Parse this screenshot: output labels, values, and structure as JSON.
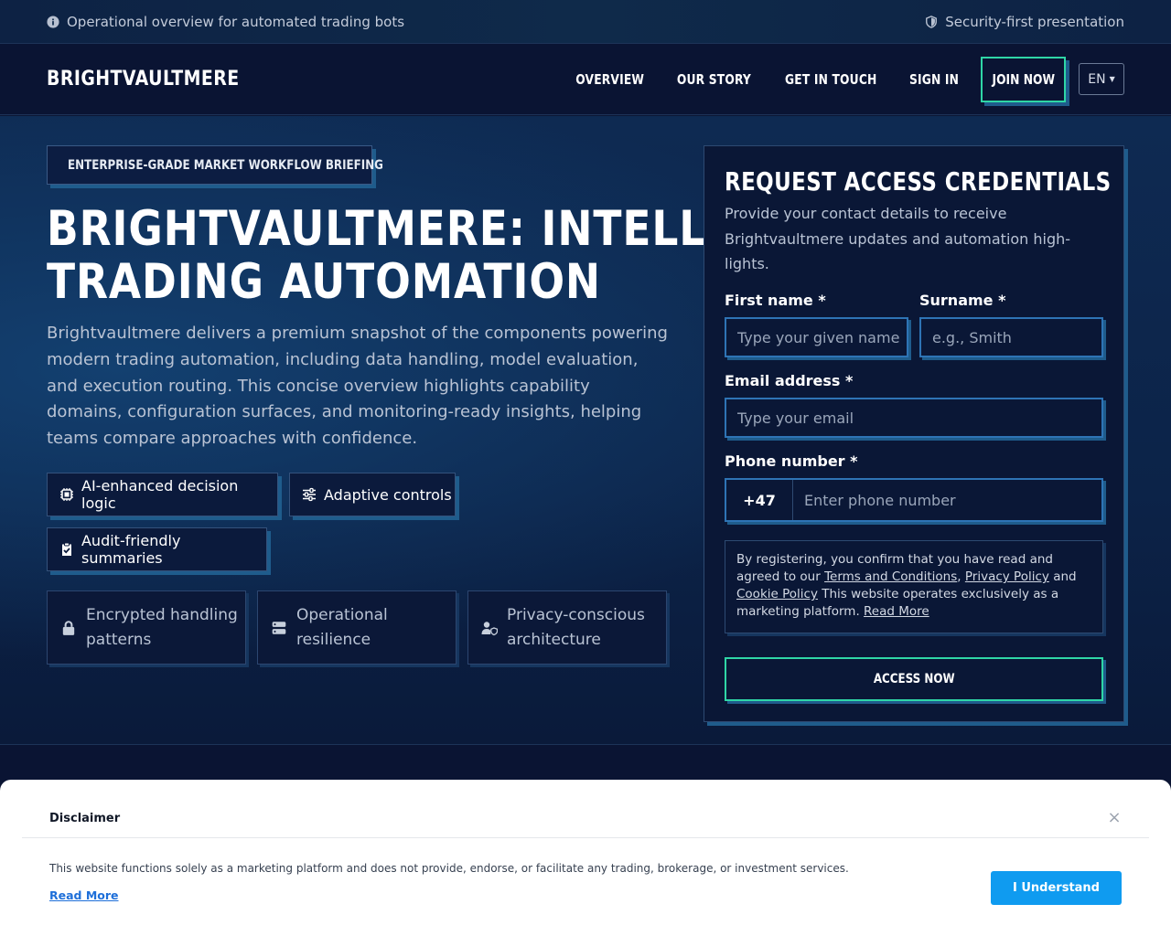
{
  "topbar": {
    "left_text": "Operational overview for automated trading bots",
    "right_text": "Security-first presentation"
  },
  "nav": {
    "brand": "BRIGHTVAULTMERE",
    "links": [
      "OVERVIEW",
      "OUR STORY",
      "GET IN TOUCH",
      "SIGN IN"
    ],
    "join_label": "JOIN NOW",
    "language": "EN"
  },
  "hero": {
    "badge": "ENTERPRISE-GRADE MARKET WORKFLOW BRIEFING",
    "headline_line1": "BRIGHTVAULTMERE: INTELLIGENT",
    "headline_line2": "TRADING AUTOMATION",
    "lead": "Brightvaultmere delivers a premium snapshot of the components powering modern trading automation, including data handling, model evaluation, and execution routing. This concise overview highlights capability domains, configuration surfaces, and monitoring-ready insights, helping teams compare approaches with confidence.",
    "chips": [
      "AI-enhanced decision logic",
      "Adaptive controls",
      "Audit-friendly summaries"
    ],
    "tiles": [
      {
        "line1": "Encrypted handling",
        "line2": "patterns"
      },
      {
        "line1": "Operational",
        "line2": "resilience"
      },
      {
        "line1": "Privacy-conscious",
        "line2": "architecture"
      }
    ]
  },
  "form": {
    "title": "REQUEST ACCESS CREDENTIALS",
    "subtitle": "Provide your contact details to receive Brightvaultmere updates and automation high­lights.",
    "first_name_label": "First name *",
    "first_name_placeholder": "Type your given name",
    "surname_label": "Surname *",
    "surname_placeholder": "e.g., Smith",
    "email_label": "Email address *",
    "email_placeholder": "Type your email",
    "phone_label": "Phone number *",
    "phone_code": "+47",
    "phone_placeholder": "Enter phone number",
    "consent": {
      "prefix": "By registering, you confirm that you have read and agreed to our",
      "terms": "Terms and Conditions",
      "comma": ",",
      "privacy": "Privacy Policy",
      "and": "and",
      "cookie": "Cookie Policy",
      "suffix": "This website operates exclusively as a marketing platform.",
      "read_more": "Read More"
    },
    "submit_label": "ACCESS NOW"
  },
  "disclaimer": {
    "title": "Disclaimer",
    "text": "This website functions solely as a marketing platform and does not provide, endorse, or facilitate any trading, brokerage, or investment services.",
    "read_more": "Read More",
    "button": "I Understand",
    "close": "×"
  },
  "colors": {
    "accent_green": "#2fd6a6",
    "accent_blue": "#0f9bf0",
    "background": "#0b1533"
  },
  "icons": {
    "topbar_left": "info-icon",
    "topbar_right": "shield-icon",
    "badge": "chart-line-icon",
    "chips": [
      "chip-icon",
      "sliders-icon",
      "clipboard-check-icon"
    ],
    "tiles": [
      "lock-icon",
      "server-icon",
      "user-shield-icon"
    ]
  }
}
